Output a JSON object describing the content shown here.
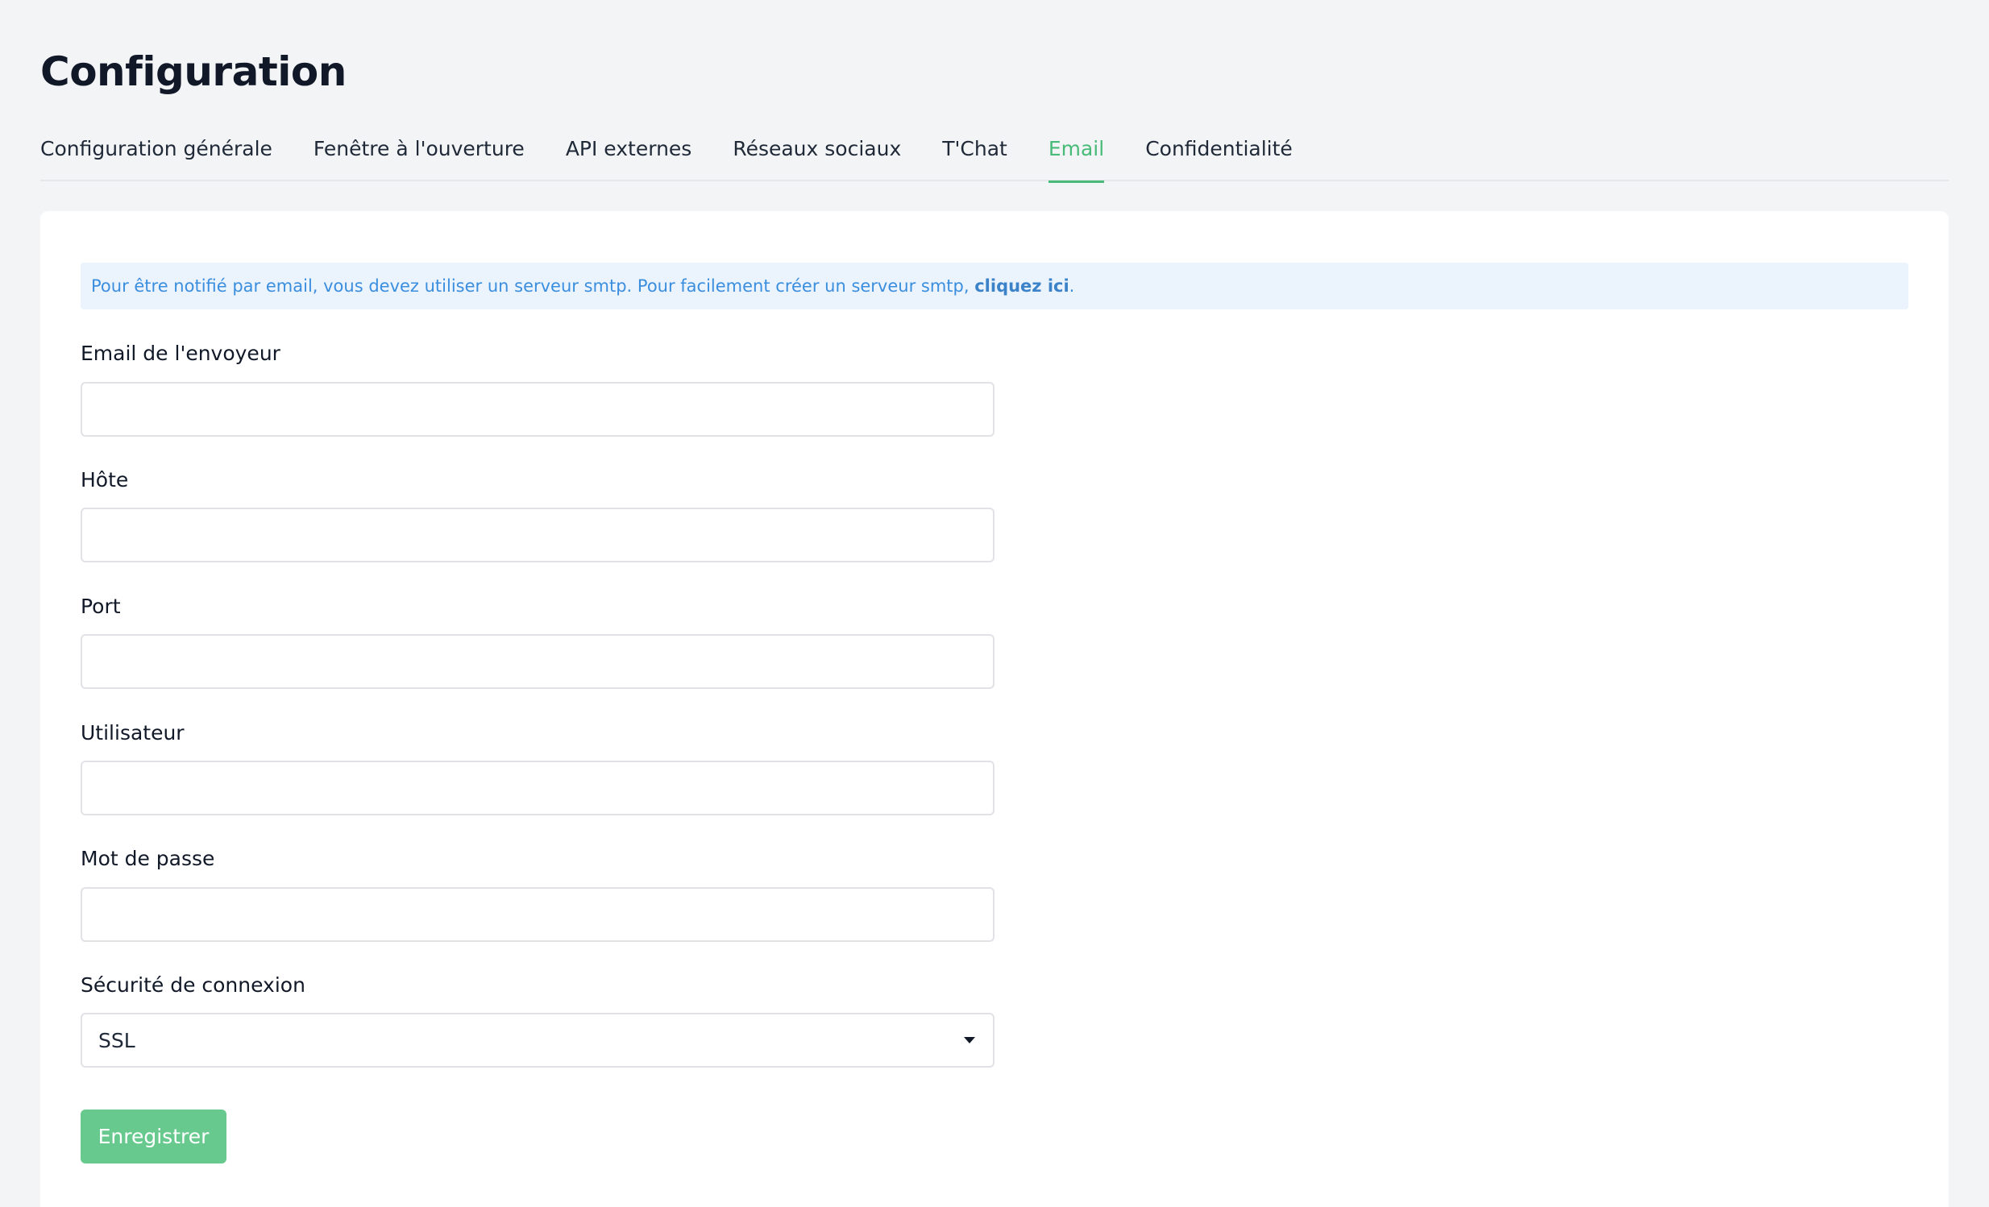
{
  "page": {
    "title": "Configuration"
  },
  "tabs": [
    {
      "label": "Configuration générale",
      "active": false
    },
    {
      "label": "Fenêtre à l'ouverture",
      "active": false
    },
    {
      "label": "API externes",
      "active": false
    },
    {
      "label": "Réseaux sociaux",
      "active": false
    },
    {
      "label": "T'Chat",
      "active": false
    },
    {
      "label": "Email",
      "active": true
    },
    {
      "label": "Confidentialité",
      "active": false
    }
  ],
  "notice": {
    "text": "Pour être notifié par email, vous devez utiliser un serveur smtp. Pour facilement créer un serveur smtp, ",
    "link_text": "cliquez ici",
    "suffix": "."
  },
  "form": {
    "sender_email": {
      "label": "Email de l'envoyeur",
      "value": ""
    },
    "host": {
      "label": "Hôte",
      "value": ""
    },
    "port": {
      "label": "Port",
      "value": ""
    },
    "user": {
      "label": "Utilisateur",
      "value": ""
    },
    "password": {
      "label": "Mot de passe",
      "value": ""
    },
    "security": {
      "label": "Sécurité de connexion",
      "value": "SSL"
    }
  },
  "actions": {
    "save_label": "Enregistrer"
  },
  "colors": {
    "accent": "#48bb78",
    "notice_text": "#3b8ede",
    "notice_bg": "#ebf4fd",
    "button_bg": "#68c98e"
  }
}
